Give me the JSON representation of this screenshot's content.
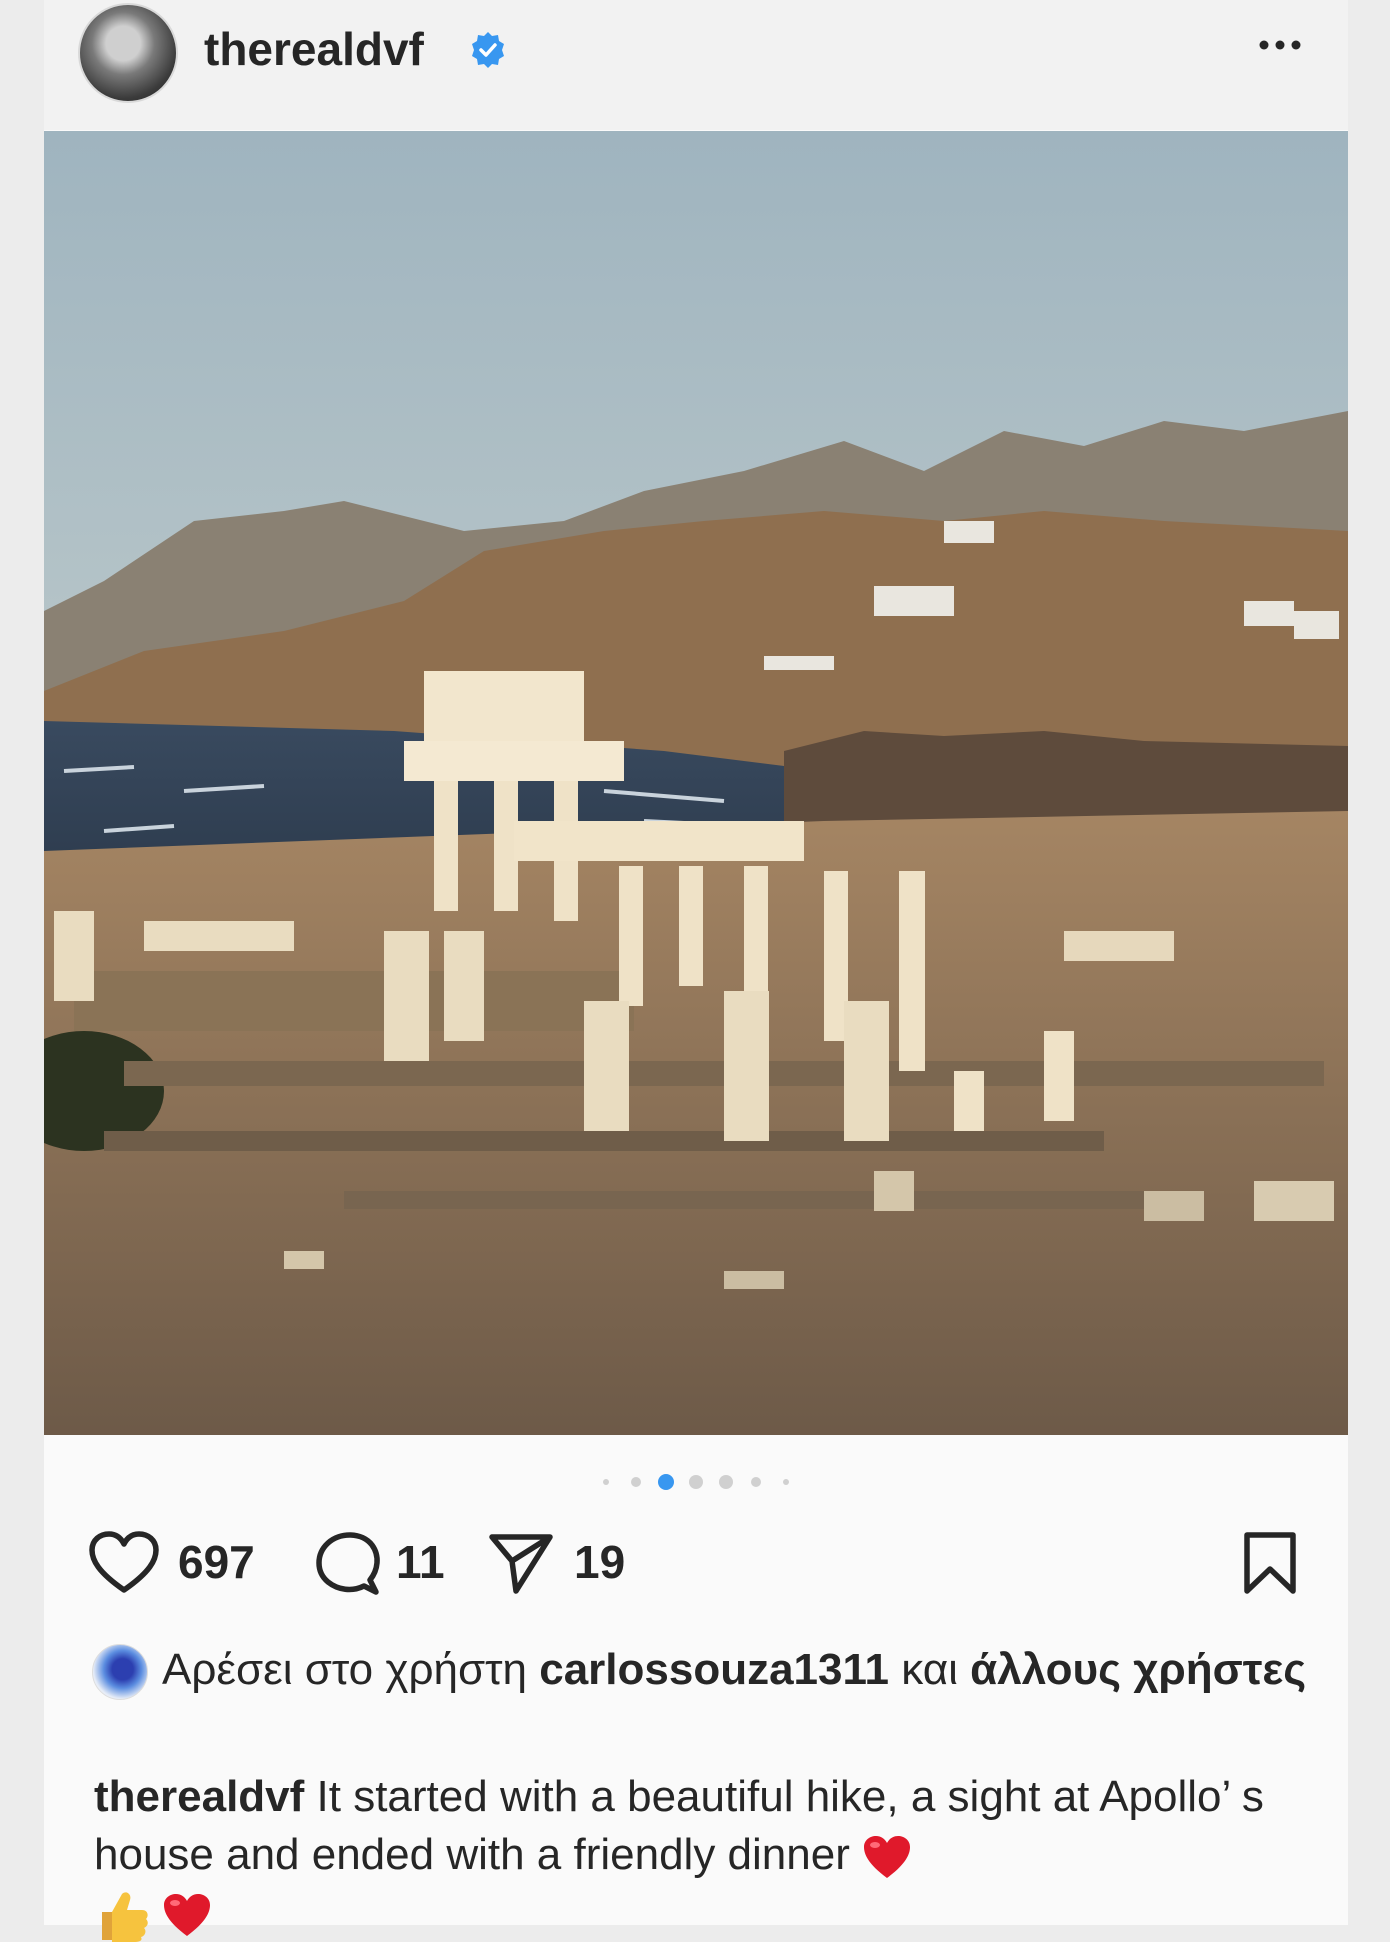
{
  "post": {
    "username": "therealdvf",
    "verified": true,
    "more_label": "•••",
    "image_alt": "Sunlit white marble columns and ruins of an ancient temple on a hillside above a rocky coast with dry hills and white houses",
    "carousel": {
      "count": 7,
      "active_index": 2
    }
  },
  "actions": {
    "likes": "697",
    "comments": "11",
    "shares": "19"
  },
  "liked_by": {
    "prefix": "Αρέσει στο χρήστη",
    "user": "carlossouza1311",
    "connector": "και",
    "others": "άλλους χρήστες"
  },
  "caption": {
    "username": "therealdvf",
    "text": "It started with a beautiful hike, a sight at Apollo’ s house and ended with a friendly dinner"
  },
  "colors": {
    "accent": "#3897f0",
    "heart_emoji": "#e0192b"
  }
}
